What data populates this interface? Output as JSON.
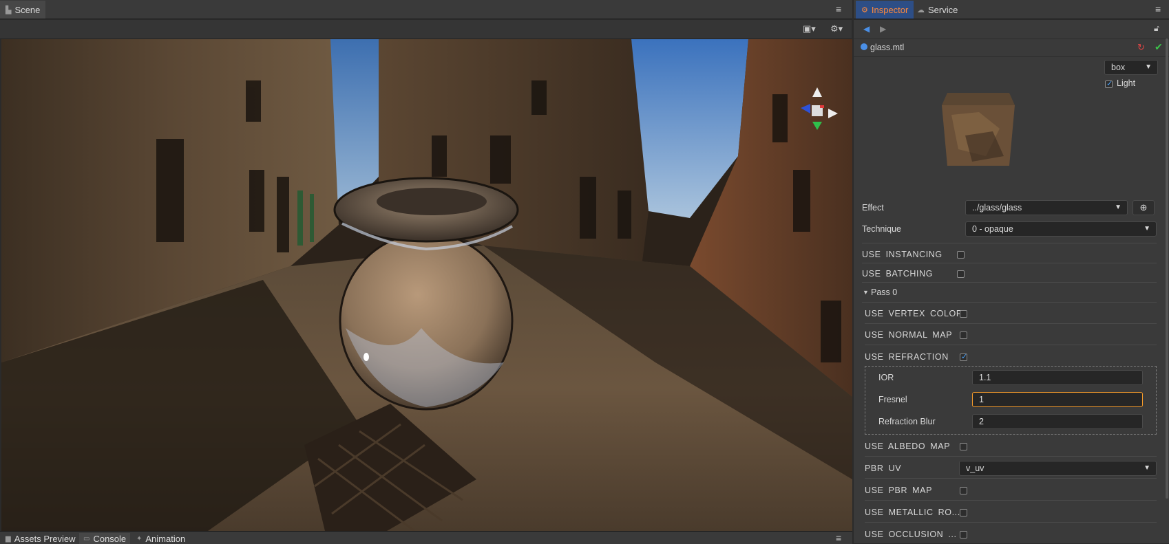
{
  "scene": {
    "tab_label": "Scene",
    "menu_icon": "hamburger-icon",
    "toolbar": {
      "camera_icon": "camera-icon",
      "gear_icon": "gear-icon"
    }
  },
  "inspector": {
    "tabs": [
      {
        "label": "Inspector",
        "active": true
      },
      {
        "label": "Service",
        "active": false
      }
    ],
    "file_name": "glass.mtl",
    "preview": {
      "shape": "box",
      "light_label": "Light",
      "light_checked": true
    },
    "effect": {
      "label": "Effect",
      "value": "../glass/glass"
    },
    "technique": {
      "label": "Technique",
      "value": "0 - opaque"
    },
    "use_instancing": {
      "label": "USE INSTANCING",
      "checked": false
    },
    "use_batching": {
      "label": "USE BATCHING",
      "checked": false
    },
    "pass": {
      "label": "Pass 0",
      "props": [
        {
          "label": "USE VERTEX COLOR",
          "checked": false
        },
        {
          "label": "USE NORMAL MAP",
          "checked": false
        },
        {
          "label": "USE REFRACTION",
          "checked": true
        }
      ],
      "refraction": {
        "ior": {
          "label": "IOR",
          "value": "1.1"
        },
        "fresnel": {
          "label": "Fresnel",
          "value": "1"
        },
        "blur": {
          "label": "Refraction Blur",
          "value": "2"
        }
      },
      "props2": [
        {
          "label": "USE ALBEDO MAP",
          "checked": false
        }
      ],
      "pbr_uv": {
        "label": "PBR UV",
        "value": "v_uv"
      },
      "props3": [
        {
          "label": "USE PBR MAP",
          "checked": false
        },
        {
          "label": "USE METALLIC RO...",
          "checked": false
        },
        {
          "label": "USE OCCLUSION ...",
          "checked": false
        }
      ]
    }
  },
  "bottom": {
    "tabs": [
      {
        "label": "Assets Preview"
      },
      {
        "label": "Console"
      },
      {
        "label": "Animation"
      }
    ]
  },
  "colors": {
    "accent": "#4a8fe6",
    "focus": "#f39a2b",
    "inspector_tab": "#ff8a3d"
  }
}
